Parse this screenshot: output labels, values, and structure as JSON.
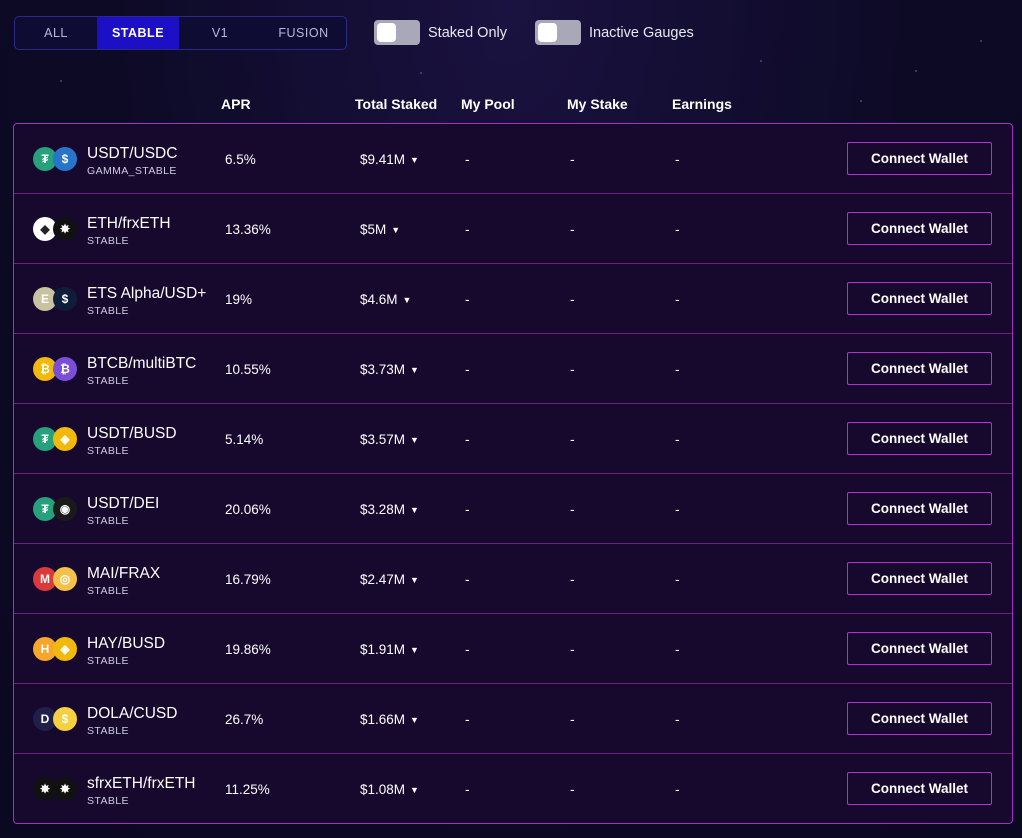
{
  "filters": {
    "tabs": [
      "ALL",
      "STABLE",
      "V1",
      "FUSION"
    ],
    "active": "STABLE"
  },
  "toggles": {
    "staked_only": {
      "label": "Staked Only",
      "on": false
    },
    "inactive_gauges": {
      "label": "Inactive Gauges",
      "on": false
    }
  },
  "columns": {
    "apr": "APR",
    "total_staked": "Total Staked",
    "my_pool": "My Pool",
    "my_stake": "My Stake",
    "earnings": "Earnings"
  },
  "rows": [
    {
      "pair": "USDT/USDC",
      "type": "GAMMA_STABLE",
      "apr": "6.5%",
      "staked": "$9.41M",
      "my_pool": "-",
      "my_stake": "-",
      "earnings": "-",
      "action": "Connect Wallet",
      "icon_a": {
        "name": "usdt-icon",
        "bg": "#26a17b",
        "glyph": "₮"
      },
      "icon_b": {
        "name": "usdc-icon",
        "bg": "#2775ca",
        "glyph": "$"
      }
    },
    {
      "pair": "ETH/frxETH",
      "type": "STABLE",
      "apr": "13.36%",
      "staked": "$5M",
      "my_pool": "-",
      "my_stake": "-",
      "earnings": "-",
      "action": "Connect Wallet",
      "icon_a": {
        "name": "eth-icon",
        "bg": "#ffffff",
        "glyph": "◆"
      },
      "icon_b": {
        "name": "frxeth-icon",
        "bg": "#111111",
        "glyph": "✸"
      }
    },
    {
      "pair": "ETS Alpha/USD+",
      "type": "STABLE",
      "apr": "19%",
      "staked": "$4.6M",
      "my_pool": "-",
      "my_stake": "-",
      "earnings": "-",
      "action": "Connect Wallet",
      "icon_a": {
        "name": "ets-alpha-icon",
        "bg": "#c8c2a0",
        "glyph": "E"
      },
      "icon_b": {
        "name": "usd-plus-icon",
        "bg": "#0e1d3a",
        "glyph": "$"
      }
    },
    {
      "pair": "BTCB/multiBTC",
      "type": "STABLE",
      "apr": "10.55%",
      "staked": "$3.73M",
      "my_pool": "-",
      "my_stake": "-",
      "earnings": "-",
      "action": "Connect Wallet",
      "icon_a": {
        "name": "btcb-icon",
        "bg": "#f0b90b",
        "glyph": "₿"
      },
      "icon_b": {
        "name": "multibtc-icon",
        "bg": "#7a4fd8",
        "glyph": "₿"
      }
    },
    {
      "pair": "USDT/BUSD",
      "type": "STABLE",
      "apr": "5.14%",
      "staked": "$3.57M",
      "my_pool": "-",
      "my_stake": "-",
      "earnings": "-",
      "action": "Connect Wallet",
      "icon_a": {
        "name": "usdt-icon",
        "bg": "#26a17b",
        "glyph": "₮"
      },
      "icon_b": {
        "name": "busd-icon",
        "bg": "#f0b90b",
        "glyph": "◈"
      }
    },
    {
      "pair": "USDT/DEI",
      "type": "STABLE",
      "apr": "20.06%",
      "staked": "$3.28M",
      "my_pool": "-",
      "my_stake": "-",
      "earnings": "-",
      "action": "Connect Wallet",
      "icon_a": {
        "name": "usdt-icon",
        "bg": "#26a17b",
        "glyph": "₮"
      },
      "icon_b": {
        "name": "dei-icon",
        "bg": "#1a1a1a",
        "glyph": "◉"
      }
    },
    {
      "pair": "MAI/FRAX",
      "type": "STABLE",
      "apr": "16.79%",
      "staked": "$2.47M",
      "my_pool": "-",
      "my_stake": "-",
      "earnings": "-",
      "action": "Connect Wallet",
      "icon_a": {
        "name": "mai-icon",
        "bg": "#db3a3a",
        "glyph": "M"
      },
      "icon_b": {
        "name": "frax-icon",
        "bg": "#f3c04a",
        "glyph": "◎"
      }
    },
    {
      "pair": "HAY/BUSD",
      "type": "STABLE",
      "apr": "19.86%",
      "staked": "$1.91M",
      "my_pool": "-",
      "my_stake": "-",
      "earnings": "-",
      "action": "Connect Wallet",
      "icon_a": {
        "name": "hay-icon",
        "bg": "#f7a62b",
        "glyph": "H"
      },
      "icon_b": {
        "name": "busd-icon",
        "bg": "#f0b90b",
        "glyph": "◈"
      }
    },
    {
      "pair": "DOLA/CUSD",
      "type": "STABLE",
      "apr": "26.7%",
      "staked": "$1.66M",
      "my_pool": "-",
      "my_stake": "-",
      "earnings": "-",
      "action": "Connect Wallet",
      "icon_a": {
        "name": "dola-icon",
        "bg": "#1f1f4a",
        "glyph": "D"
      },
      "icon_b": {
        "name": "cusd-icon",
        "bg": "#f5d142",
        "glyph": "$"
      }
    },
    {
      "pair": "sfrxETH/frxETH",
      "type": "STABLE",
      "apr": "11.25%",
      "staked": "$1.08M",
      "my_pool": "-",
      "my_stake": "-",
      "earnings": "-",
      "action": "Connect Wallet",
      "icon_a": {
        "name": "sfrxeth-icon",
        "bg": "#111111",
        "glyph": "✸"
      },
      "icon_b": {
        "name": "frxeth-icon",
        "bg": "#111111",
        "glyph": "✸"
      }
    }
  ]
}
